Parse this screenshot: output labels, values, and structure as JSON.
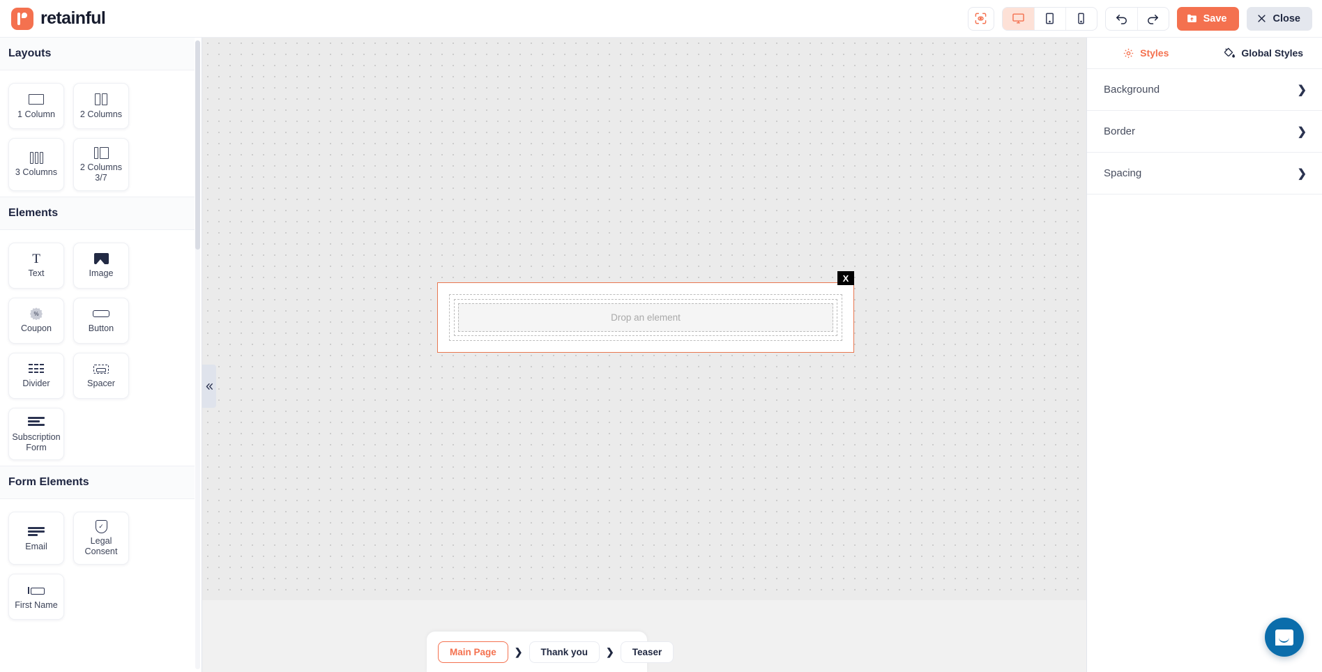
{
  "app": {
    "brand_name": "retainful",
    "brand_icon": "retainful-logo-icon"
  },
  "toolbar": {
    "preview_icon": "eye-scan-icon",
    "devices": [
      {
        "name": "desktop",
        "icon": "desktop-icon",
        "active": true
      },
      {
        "name": "tablet",
        "icon": "tablet-icon",
        "active": false
      },
      {
        "name": "mobile",
        "icon": "mobile-icon",
        "active": false
      }
    ],
    "undo_icon": "undo-arrow-icon",
    "redo_icon": "redo-arrow-icon",
    "save_label": "Save",
    "save_icon": "folder-upload-icon",
    "save_color": "#f4714f",
    "close_label": "Close",
    "close_icon": "close-x-icon"
  },
  "sidebar": {
    "sections": [
      {
        "title": "Layouts",
        "items": [
          {
            "label": "1 Column",
            "icon": "one-column-icon"
          },
          {
            "label": "2 Columns",
            "icon": "two-columns-icon"
          },
          {
            "label": "3 Columns",
            "icon": "three-columns-icon"
          },
          {
            "label": "2 Columns 3/7",
            "icon": "two-columns-3-7-icon"
          }
        ]
      },
      {
        "title": "Elements",
        "items": [
          {
            "label": "Text",
            "icon": "text-icon"
          },
          {
            "label": "Image",
            "icon": "image-icon"
          },
          {
            "label": "Coupon",
            "icon": "coupon-icon"
          },
          {
            "label": "Button",
            "icon": "button-icon"
          },
          {
            "label": "Divider",
            "icon": "divider-icon"
          },
          {
            "label": "Spacer",
            "icon": "spacer-icon"
          },
          {
            "label": "Subscription Form",
            "icon": "subscription-form-icon"
          }
        ]
      },
      {
        "title": "Form Elements",
        "items": [
          {
            "label": "Email",
            "icon": "email-field-icon"
          },
          {
            "label": "Legal Consent",
            "icon": "shield-check-icon"
          },
          {
            "label": "First Name",
            "icon": "first-name-field-icon"
          }
        ]
      }
    ],
    "collapse_icon": "chevron-double-left-icon"
  },
  "canvas": {
    "drop_placeholder": "Drop an element",
    "delete_badge_label": "X",
    "selection_color": "#e8764f"
  },
  "pagebar": {
    "tabs": [
      {
        "label": "Main Page",
        "active": true
      },
      {
        "label": "Thank you",
        "active": false
      },
      {
        "label": "Teaser",
        "active": false
      }
    ],
    "separator": "❯"
  },
  "right_panel": {
    "tabs": [
      {
        "label": "Styles",
        "icon": "gear-icon",
        "active": true
      },
      {
        "label": "Global Styles",
        "icon": "paint-bucket-icon",
        "active": false
      }
    ],
    "rows": [
      {
        "label": "Background",
        "icon": "chevron-right-icon"
      },
      {
        "label": "Border",
        "icon": "chevron-right-icon"
      },
      {
        "label": "Spacing",
        "icon": "chevron-right-icon"
      }
    ]
  },
  "chat": {
    "icon": "chat-bubble-icon",
    "color": "#0b6dab"
  }
}
